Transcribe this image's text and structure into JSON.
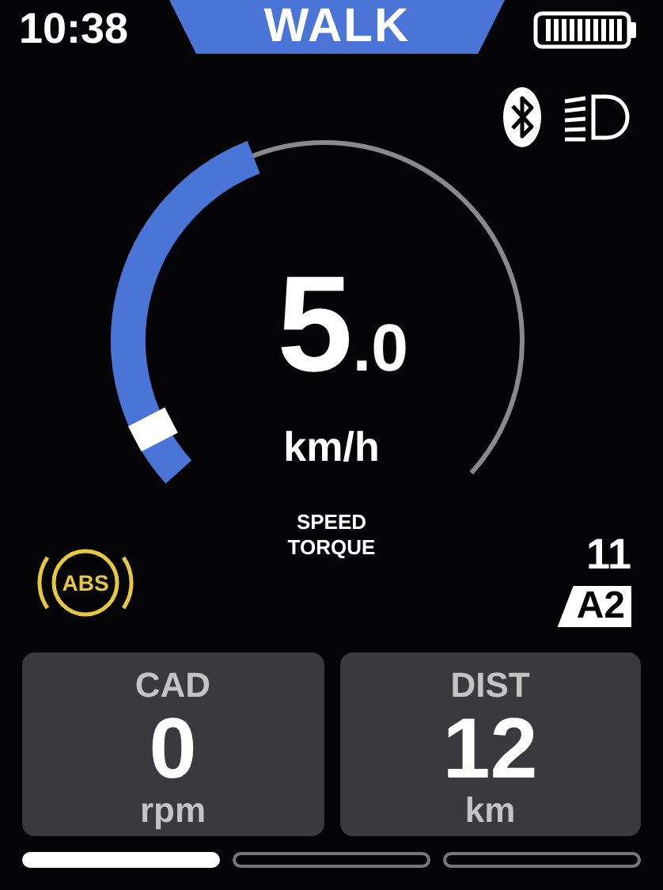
{
  "status_bar": {
    "time": "10:38",
    "mode": "WALK"
  },
  "speed": {
    "value": "5",
    "decimal": ".0",
    "unit": "km/h"
  },
  "sensor_modes": [
    "SPEED",
    "TORQUE"
  ],
  "warning": {
    "label": "ABS"
  },
  "assist": {
    "level_number": "11",
    "badge": "A2"
  },
  "cards": [
    {
      "label": "CAD",
      "value": "0",
      "unit": "rpm"
    },
    {
      "label": "DIST",
      "value": "12",
      "unit": "km"
    }
  ],
  "pages": [
    {
      "selected": true
    },
    {
      "selected": false
    },
    {
      "selected": false
    }
  ]
}
